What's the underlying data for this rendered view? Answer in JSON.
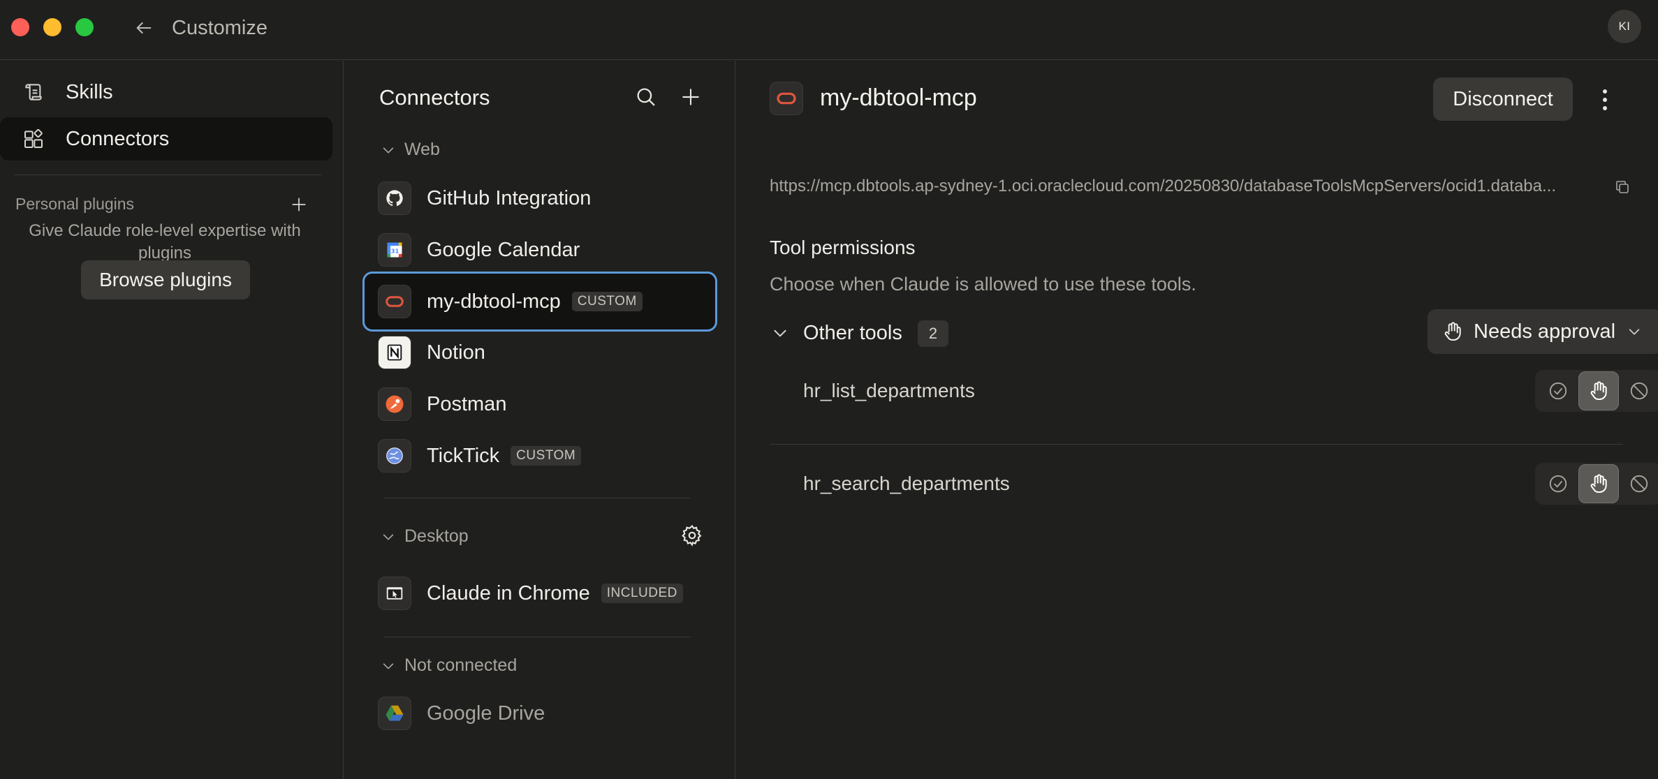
{
  "window": {
    "title": "Customize",
    "avatar_initials": "KI"
  },
  "sidebar": {
    "items": [
      {
        "label": "Skills",
        "icon": "scroll-icon"
      },
      {
        "label": "Connectors",
        "icon": "connectors-grid-icon"
      }
    ],
    "personal_plugins_label": "Personal plugins",
    "plugins_description": "Give Claude role-level expertise with plugins",
    "browse_plugins_label": "Browse plugins"
  },
  "connectors": {
    "title": "Connectors",
    "sections": {
      "web": "Web",
      "desktop": "Desktop",
      "not_connected": "Not connected"
    },
    "web_items": [
      {
        "name": "GitHub Integration",
        "badge": ""
      },
      {
        "name": "Google Calendar",
        "badge": ""
      },
      {
        "name": "my-dbtool-mcp",
        "badge": "CUSTOM"
      },
      {
        "name": "Notion",
        "badge": ""
      },
      {
        "name": "Postman",
        "badge": ""
      },
      {
        "name": "TickTick",
        "badge": "CUSTOM"
      }
    ],
    "desktop_items": [
      {
        "name": "Claude in Chrome",
        "badge": "INCLUDED"
      }
    ],
    "not_connected_items": [
      {
        "name": "Google Drive"
      }
    ]
  },
  "detail": {
    "name": "my-dbtool-mcp",
    "disconnect_label": "Disconnect",
    "url": "https://mcp.dbtools.ap-sydney-1.oci.oraclecloud.com/20250830/databaseToolsMcpServers/ocid1.databa...",
    "permissions_title": "Tool permissions",
    "permissions_desc": "Choose when Claude is allowed to use these tools.",
    "group": {
      "label": "Other tools",
      "count": "2",
      "approval_label": "Needs approval"
    },
    "tools": [
      {
        "name": "hr_list_departments",
        "mode": "needs-approval"
      },
      {
        "name": "hr_search_departments",
        "mode": "needs-approval"
      }
    ]
  },
  "colors": {
    "background": "#1f1f1e",
    "selected_outline": "#5b9ad9",
    "oracle_red": "#e0563e",
    "postman_orange": "#ef6a3a"
  }
}
